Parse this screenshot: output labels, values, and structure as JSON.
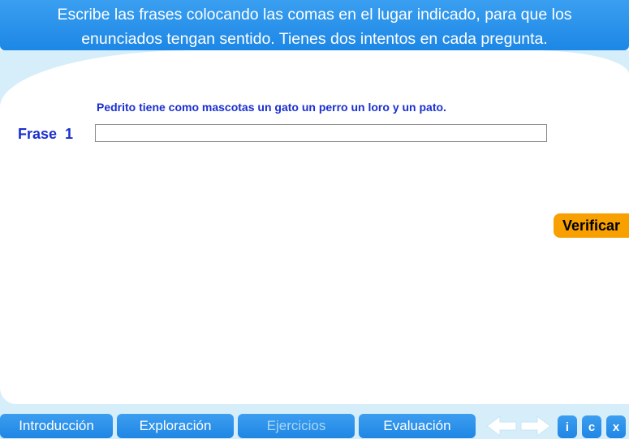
{
  "header": {
    "instruction_line1": "Escribe las frases colocando las comas en el lugar indicado, para que los",
    "instruction_line2": "enunciados tengan sentido. Tienes dos intentos en cada pregunta."
  },
  "exercise": {
    "prompt": "Pedrito tiene como mascotas un gato un perro un loro y un pato.",
    "label": "Frase  1",
    "answer_value": "",
    "verify_label": "Verificar"
  },
  "nav": {
    "tabs": [
      {
        "label": "Introducción"
      },
      {
        "label": "Exploración"
      },
      {
        "label": "Ejercicios"
      },
      {
        "label": "Evaluación"
      }
    ],
    "active_tab": "Ejercicios",
    "buttons": {
      "info": "i",
      "credits": "c",
      "close": "x"
    }
  },
  "colors": {
    "header_blue": "#1d87e6",
    "prompt_blue": "#1a2fd0",
    "verify_orange": "#f7a000",
    "backdrop": "#d6eef9"
  }
}
